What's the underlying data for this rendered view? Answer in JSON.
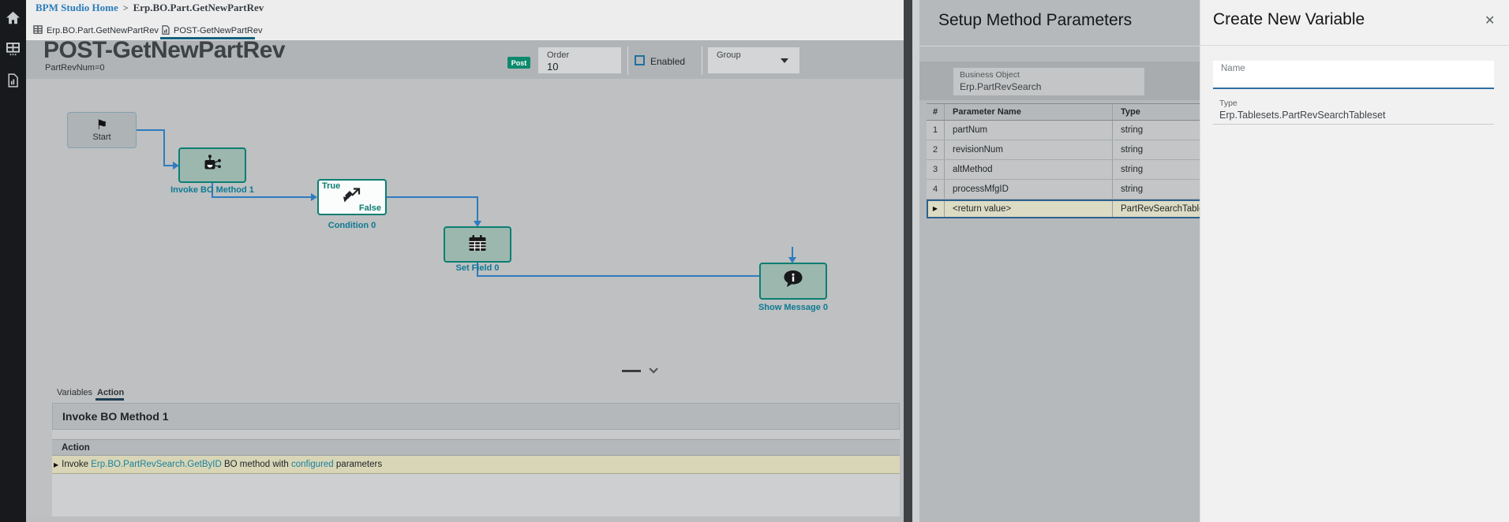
{
  "breadcrumb": {
    "home": "BPM Studio Home",
    "separator": ">",
    "current": "Erp.BO.Part.GetNewPartRev"
  },
  "tabs": [
    {
      "label": "Erp.BO.Part.GetNewPartRev",
      "icon": "grid-icon",
      "active": false
    },
    {
      "label": "POST-GetNewPartRev",
      "icon": "document-icon",
      "active": true
    }
  ],
  "header": {
    "title": "POST-GetNewPartRev",
    "subtitle": "PartRevNum=0",
    "post_badge": "Post",
    "order_label": "Order",
    "order_value": "10",
    "enabled_label": "Enabled",
    "group_label": "Group"
  },
  "flow": {
    "nodes": [
      {
        "id": "start",
        "label": "Start",
        "icon": "flag-icon"
      },
      {
        "id": "invoke-bo-method-1",
        "label": "Invoke BO Method 1",
        "icon": "robot-icon"
      },
      {
        "id": "condition-0",
        "label": "Condition 0",
        "icon": "branch-arrows-icon",
        "true_label": "True",
        "false_label": "False"
      },
      {
        "id": "set-field-0",
        "label": "Set Field 0",
        "icon": "calendar-icon"
      },
      {
        "id": "show-message-0",
        "label": "Show Message 0",
        "icon": "message-bubble-icon"
      }
    ],
    "connector_color": "#2e7cc0"
  },
  "bottom_panel": {
    "tabs": [
      {
        "label": "Variables",
        "active": false
      },
      {
        "label": "Action",
        "active": true
      }
    ],
    "header": "Invoke BO Method 1",
    "section_label": "Action",
    "action_row": {
      "marker": "▶",
      "prefix": "Invoke ",
      "link1": "Erp.BO.PartRevSearch.GetByID",
      "middle": " BO method with ",
      "link2": "configured",
      "suffix": " parameters"
    }
  },
  "setup_panel": {
    "title": "Setup Method Parameters",
    "business_object_label": "Business Object",
    "business_object_value": "Erp.PartRevSearch",
    "table": {
      "columns": [
        "#",
        "Parameter Name",
        "Type"
      ],
      "rows": [
        {
          "num": "1",
          "name": "partNum",
          "type": "string"
        },
        {
          "num": "2",
          "name": "revisionNum",
          "type": "string"
        },
        {
          "num": "3",
          "name": "altMethod",
          "type": "string"
        },
        {
          "num": "4",
          "name": "processMfgID",
          "type": "string"
        },
        {
          "num": "▶",
          "name": "<return value>",
          "type": "PartRevSearchTableset",
          "selected": true
        }
      ]
    }
  },
  "create_variable_panel": {
    "title": "Create New Variable",
    "close_glyph": "✕",
    "name_placeholder": "Name",
    "type_label": "Type",
    "type_value": "Erp.Tablesets.PartRevSearchTableset"
  },
  "colors": {
    "accent_teal": "#0a7f72",
    "node_fill": "#9cb7ae",
    "connector_blue": "#2e7cc0",
    "post_badge": "#0c8a6d",
    "selected_row_bg": "#dcdbc3",
    "selected_row_border": "#2d608f",
    "active_tab_underline": "#11607c",
    "link_blue": "#2b7cb8",
    "sidebar_bg": "#17191c"
  }
}
